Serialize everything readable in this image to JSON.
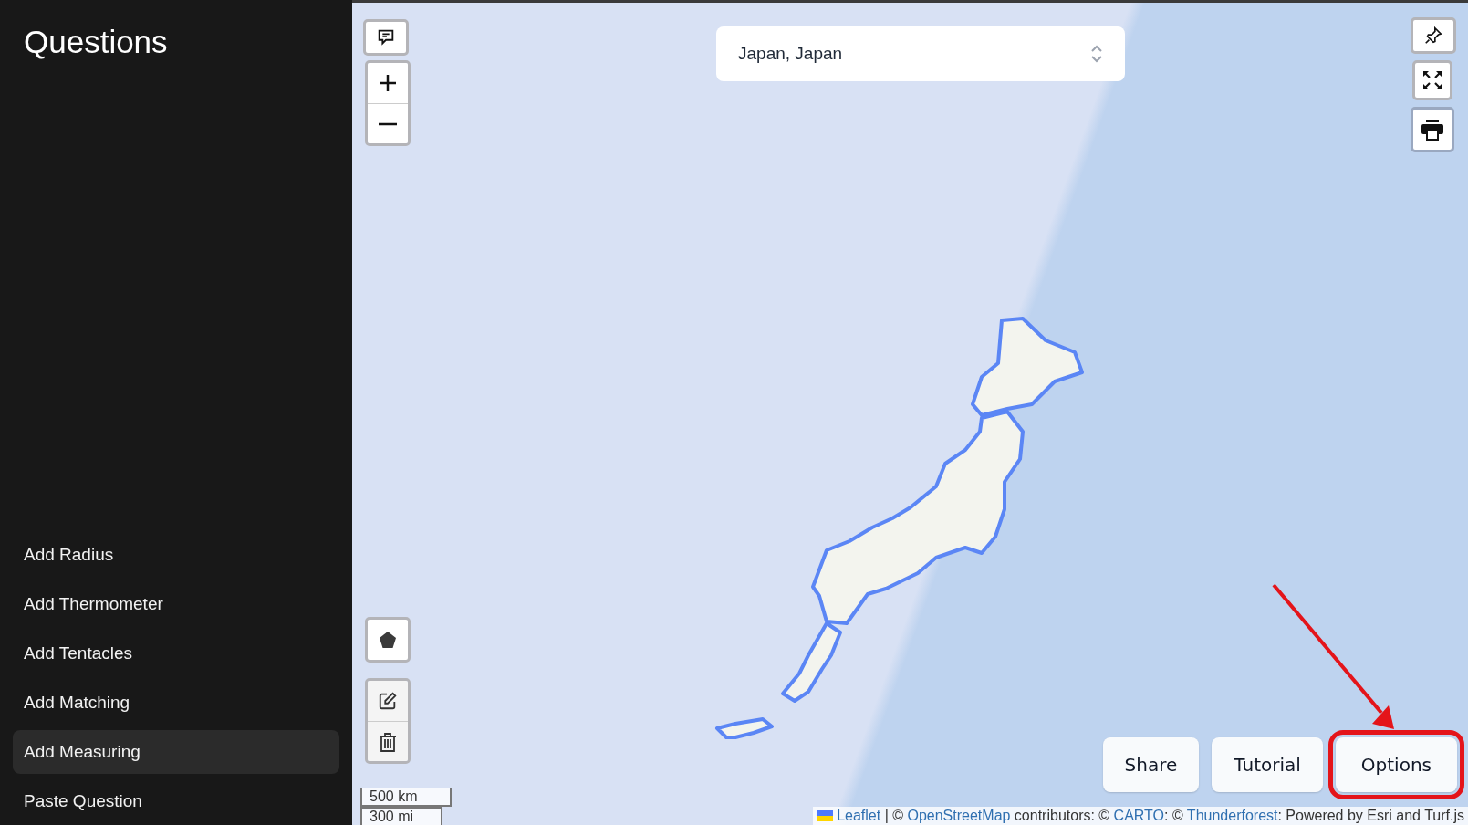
{
  "sidebar": {
    "title": "Questions",
    "items": [
      {
        "label": "Add Radius",
        "selected": false
      },
      {
        "label": "Add Thermometer",
        "selected": false
      },
      {
        "label": "Add Tentacles",
        "selected": false
      },
      {
        "label": "Add Matching",
        "selected": false
      },
      {
        "label": "Add Measuring",
        "selected": true
      },
      {
        "label": "Paste Question",
        "selected": false
      }
    ]
  },
  "map": {
    "location_select": {
      "value": "Japan, Japan"
    },
    "scale": [
      "500 km",
      "300 mi"
    ],
    "buttons": [
      {
        "label": "Share",
        "highlighted": false
      },
      {
        "label": "Tutorial",
        "highlighted": false
      },
      {
        "label": "Options",
        "highlighted": true
      }
    ],
    "attribution": [
      {
        "kind": "link",
        "text": "Leaflet"
      },
      {
        "kind": "text",
        "text": " | © "
      },
      {
        "kind": "link",
        "text": "OpenStreetMap"
      },
      {
        "kind": "text",
        "text": " contributors: © "
      },
      {
        "kind": "link",
        "text": "CARTO"
      },
      {
        "kind": "text",
        "text": ": © "
      },
      {
        "kind": "link",
        "text": "Thunderforest"
      },
      {
        "kind": "text",
        "text": ": Powered by Esri and Turf.js"
      }
    ]
  }
}
